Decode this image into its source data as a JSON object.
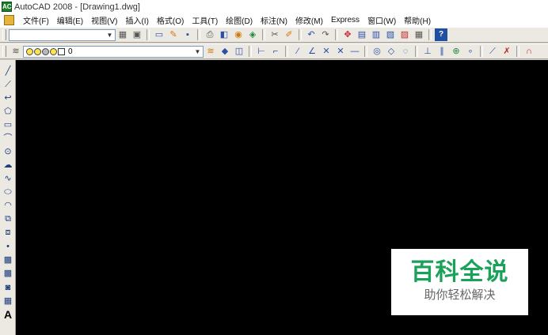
{
  "window": {
    "title": "AutoCAD 2008 - [Drawing1.dwg]",
    "app_icon_text": "AC"
  },
  "menu": [
    "文件(F)",
    "编辑(E)",
    "视图(V)",
    "插入(I)",
    "格式(O)",
    "工具(T)",
    "绘图(D)",
    "标注(N)",
    "修改(M)",
    "Express",
    "窗口(W)",
    "帮助(H)"
  ],
  "toolbar1": {
    "workspace_value": "",
    "buttons": [
      {
        "icon": "workspace-settings-icon",
        "glyph": "▦"
      },
      {
        "icon": "my-workspace-icon",
        "glyph": "▣"
      },
      {
        "icon": "new-icon",
        "glyph": "▭"
      },
      {
        "icon": "open-icon",
        "glyph": "✎"
      },
      {
        "icon": "save-icon",
        "glyph": "▪"
      },
      {
        "icon": "plot-icon",
        "glyph": "⎙"
      },
      {
        "icon": "plot-preview-icon",
        "glyph": "◧"
      },
      {
        "icon": "publish-icon",
        "glyph": "◉"
      },
      {
        "icon": "3d-dwf-icon",
        "glyph": "◈"
      },
      {
        "icon": "cut-icon",
        "glyph": "✂"
      },
      {
        "icon": "match-properties-icon",
        "glyph": "✐"
      },
      {
        "icon": "undo-icon",
        "glyph": "↶"
      },
      {
        "icon": "redo-icon",
        "glyph": "↷"
      },
      {
        "icon": "pan-icon",
        "glyph": "✥"
      },
      {
        "icon": "properties-icon",
        "glyph": "▤"
      },
      {
        "icon": "design-center-icon",
        "glyph": "▥"
      },
      {
        "icon": "tool-palettes-icon",
        "glyph": "▧"
      },
      {
        "icon": "sheet-set-icon",
        "glyph": "▨"
      },
      {
        "icon": "calculator-icon",
        "glyph": "▦"
      },
      {
        "icon": "help-icon",
        "glyph": "?"
      }
    ]
  },
  "toolbar2": {
    "layer_value": "0",
    "buttons": [
      {
        "icon": "make-layer-current-icon",
        "glyph": "≋"
      },
      {
        "icon": "layer-previous-icon",
        "glyph": "◆"
      },
      {
        "icon": "layer-states-icon",
        "glyph": "◫"
      },
      {
        "icon": "linear-dim-icon",
        "glyph": "⊢"
      },
      {
        "icon": "ordinate-dim-icon",
        "glyph": "⌐"
      },
      {
        "icon": "aligned-dim-icon",
        "glyph": "⁄"
      },
      {
        "icon": "angular-dim-icon",
        "glyph": "∠"
      },
      {
        "icon": "tangent-snap-icon",
        "glyph": "✕"
      },
      {
        "icon": "intersection-snap-icon",
        "glyph": "✕"
      },
      {
        "icon": "extension-snap-icon",
        "glyph": "—"
      },
      {
        "icon": "center-snap-icon",
        "glyph": "◎"
      },
      {
        "icon": "quadrant-snap-icon",
        "glyph": "◇"
      },
      {
        "icon": "tangent-circle-icon",
        "glyph": "◌"
      },
      {
        "icon": "perpendicular-snap-icon",
        "glyph": "⊥"
      },
      {
        "icon": "parallel-snap-icon",
        "glyph": "∥"
      },
      {
        "icon": "insert-snap-icon",
        "glyph": "⊕"
      },
      {
        "icon": "node-snap-icon",
        "glyph": "∘"
      },
      {
        "icon": "nearest-snap-icon",
        "glyph": "⟋"
      },
      {
        "icon": "snap-none-icon",
        "glyph": "✗"
      },
      {
        "icon": "osnap-settings-icon",
        "glyph": "∩"
      }
    ]
  },
  "draw_tools": [
    {
      "icon": "line-icon",
      "glyph": "╱"
    },
    {
      "icon": "construction-line-icon",
      "glyph": "⟋"
    },
    {
      "icon": "polyline-icon",
      "glyph": "↩"
    },
    {
      "icon": "polygon-icon",
      "glyph": "⬠"
    },
    {
      "icon": "rectangle-icon",
      "glyph": "▭"
    },
    {
      "icon": "arc-icon",
      "glyph": "⌒"
    },
    {
      "icon": "circle-icon",
      "glyph": "⊙"
    },
    {
      "icon": "revision-cloud-icon",
      "glyph": "☁"
    },
    {
      "icon": "spline-icon",
      "glyph": "∿"
    },
    {
      "icon": "ellipse-icon",
      "glyph": "⬭"
    },
    {
      "icon": "ellipse-arc-icon",
      "glyph": "◠"
    },
    {
      "icon": "insert-block-icon",
      "glyph": "⧉"
    },
    {
      "icon": "make-block-icon",
      "glyph": "⧈"
    },
    {
      "icon": "point-icon",
      "glyph": "•"
    },
    {
      "icon": "hatch-icon",
      "glyph": "▩"
    },
    {
      "icon": "gradient-icon",
      "glyph": "▩"
    },
    {
      "icon": "region-icon",
      "glyph": "◙"
    },
    {
      "icon": "table-icon",
      "glyph": "▦"
    },
    {
      "icon": "multiline-text-icon",
      "glyph": "A"
    }
  ],
  "watermark": {
    "title": "百科全说",
    "subtitle": "助你轻松解决"
  },
  "colors": {
    "canvas": "#000000",
    "watermark_green": "#1aa25a"
  }
}
